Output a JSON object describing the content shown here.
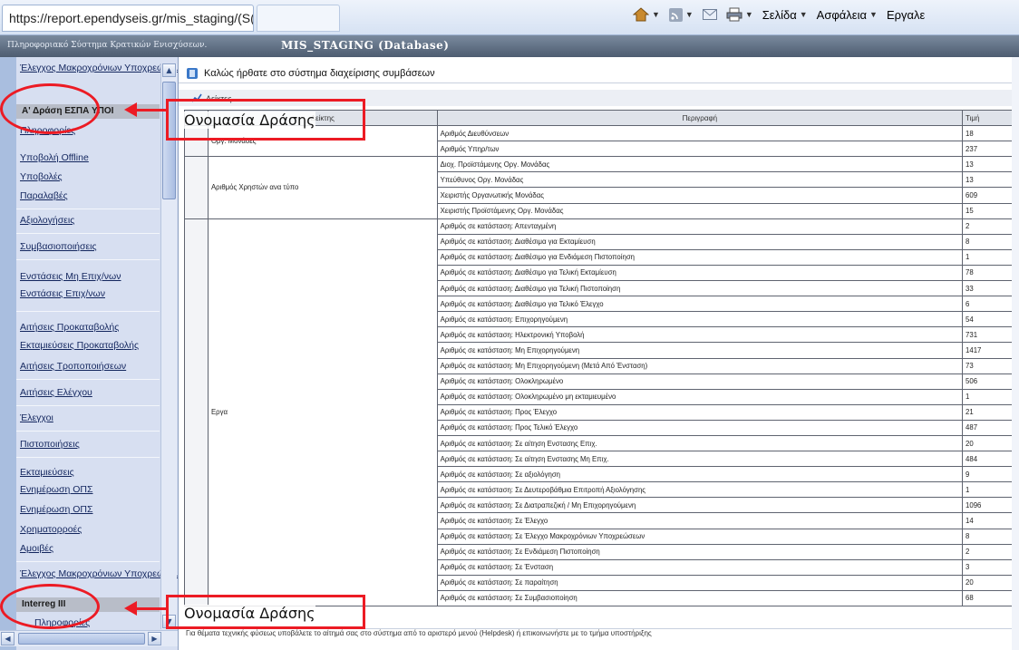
{
  "browser": {
    "tab_title": "https://report.ependyseis.gr/mis_staging/(S(x2rpc0u...",
    "commands": [
      "Σελίδα",
      "Ασφάλεια",
      "Εργαλε"
    ]
  },
  "app_header": {
    "system_name": "Πληροφοριακό Σύστημα Κρατικών Ενισχύσεων.",
    "database": "MIS_STAGING (Database)"
  },
  "sidebar": {
    "top_link": "Έλεγχος Μακροχρόνιων Υποχρεώσεων",
    "section_a": "Α' Δράση ΕΣΠΑ ΥΠΟΙ",
    "links": [
      "Πληροφορίες",
      "Υποβολή Offline",
      "Υποβολές",
      "Παραλαβές",
      "Αξιολογήσεις",
      "Συμβασιοποιήσεις",
      "Ενστάσεις Μη Επιχ/νων",
      "Ενστάσεις Επιχ/νων",
      "Αιτήσεις Προκαταβολής",
      "Εκταμιεύσεις Προκαταβολής",
      "Αιτήσεις Τροποποιήσεων",
      "Αιτήσεις Ελέγχου",
      "Έλεγχοι",
      "Πιστοποιήσεις",
      "Εκταμιεύσεις",
      "Ενημέρωση ΟΠΣ",
      "Ενημέρωση ΟΠΣ",
      "Χρηματορροές",
      "Αμοιβές",
      "Έλεγχος Μακροχρόνιων Υποχρεώσεων"
    ],
    "section_b": "Interreg III",
    "last_link": "Πληροφορίες"
  },
  "main": {
    "welcome": "Καλώς ήρθατε στο σύστημα διαχείρισης συμβάσεων",
    "indicators_label": "Δείκτες",
    "columns": [
      "Δείκτης",
      "Περιγραφή",
      "Τιμή"
    ],
    "groups": [
      {
        "name": "Οργ. Μονάδες",
        "rows": [
          {
            "desc": "Αριθμός Διευθύνσεων",
            "value": "18"
          },
          {
            "desc": "Αριθμός Υπηρ/των",
            "value": "237"
          }
        ]
      },
      {
        "name": "Αριθμός Χρηστών ανα τύπο",
        "rows": [
          {
            "desc": "Διοχ. Προϊστάμενης Οργ. Μονάδας",
            "value": "13"
          },
          {
            "desc": "Υπεύθυνος Οργ. Μονάδας",
            "value": "13"
          },
          {
            "desc": "Χειριστής Οργανωτικής Μονάδας",
            "value": "609"
          },
          {
            "desc": "Χειριστής Προϊστάμενης Οργ. Μονάδας",
            "value": "15"
          }
        ]
      },
      {
        "name": "Εργα",
        "rows": [
          {
            "desc": "Αριθμός σε κατάσταση: Απενταγμένη",
            "value": "2"
          },
          {
            "desc": "Αριθμός σε κατάσταση: Διαθέσιμα για Εκταμίευση",
            "value": "8"
          },
          {
            "desc": "Αριθμός σε κατάσταση: Διαθέσιμο για Ενδιάμεση Πιστοποίηση",
            "value": "1"
          },
          {
            "desc": "Αριθμός σε κατάσταση: Διαθέσιμο για Τελική Εκταμίευση",
            "value": "78"
          },
          {
            "desc": "Αριθμός σε κατάσταση: Διαθέσιμο για Τελική Πιστοποίηση",
            "value": "33"
          },
          {
            "desc": "Αριθμός σε κατάσταση: Διαθέσιμο για Τελικό Έλεγχο",
            "value": "6"
          },
          {
            "desc": "Αριθμός σε κατάσταση: Επιχορηγούμενη",
            "value": "54"
          },
          {
            "desc": "Αριθμός σε κατάσταση: Ηλεκτρονική Υποβολή",
            "value": "731"
          },
          {
            "desc": "Αριθμός σε κατάσταση: Μη Επιχορηγούμενη",
            "value": "1417"
          },
          {
            "desc": "Αριθμός σε κατάσταση: Μη Επιχορηγούμενη (Μετά Από Ένσταση)",
            "value": "73"
          },
          {
            "desc": "Αριθμός σε κατάσταση: Ολοκληρωμένο",
            "value": "506"
          },
          {
            "desc": "Αριθμός σε κατάσταση: Ολοκληρωμένο μη εκταμιευμένο",
            "value": "1"
          },
          {
            "desc": "Αριθμός σε κατάσταση: Προς Έλεγχο",
            "value": "21"
          },
          {
            "desc": "Αριθμός σε κατάσταση: Προς Τελικό Έλεγχο",
            "value": "487"
          },
          {
            "desc": "Αριθμός σε κατάσταση: Σε αίτηση Ενστασης Επιχ.",
            "value": "20"
          },
          {
            "desc": "Αριθμός σε κατάσταση: Σε αίτηση Ενστασης Μη Επιχ.",
            "value": "484"
          },
          {
            "desc": "Αριθμός σε κατάσταση: Σε αξιολόγηση",
            "value": "9"
          },
          {
            "desc": "Αριθμός σε κατάσταση: Σε Δευτεροβάθμια Επιτροπή Αξιολόγησης",
            "value": "1"
          },
          {
            "desc": "Αριθμός σε κατάσταση: Σε Διατραπεζική / Μη Επιχορηγούμενη",
            "value": "1096"
          },
          {
            "desc": "Αριθμός σε κατάσταση: Σε Έλεγχο",
            "value": "14"
          },
          {
            "desc": "Αριθμός σε κατάσταση: Σε Έλεγχο Μακροχρόνιων Υποχρεώσεων",
            "value": "8"
          },
          {
            "desc": "Αριθμός σε κατάσταση: Σε Ενδιάμεση Πιστοποίηση",
            "value": "2"
          },
          {
            "desc": "Αριθμός σε κατάσταση: Σε Ένσταση",
            "value": "3"
          },
          {
            "desc": "Αριθμός σε κατάσταση: Σε παραίτηση",
            "value": "20"
          },
          {
            "desc": "Αριθμός σε κατάσταση: Σε Συμβασιοποίηση",
            "value": "68"
          }
        ]
      }
    ],
    "footer": "Για θέματα τεχνικής φύσεως υποβάλετε το αίτημά σας στο σύστημα από το αριστερό μενού (Helpdesk) ή επικοινωνήστε με το τμήμα υποστήριξης"
  },
  "annotations": {
    "label_top": "Ονομασία Δράσης",
    "label_bottom": "Ονομασία Δράσης",
    "color": "#ec1b24"
  }
}
